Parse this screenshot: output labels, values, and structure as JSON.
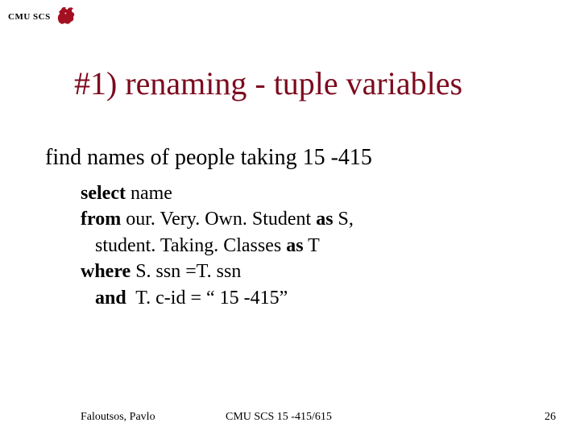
{
  "header": {
    "org": "CMU SCS"
  },
  "title": "#1) renaming - tuple variables",
  "subtitle": "find names of people taking 15 -415",
  "code": {
    "l1": {
      "kw": "select",
      "rest": " name"
    },
    "l2": {
      "kw1": "from",
      "mid": " our. Very. Own. Student ",
      "kw2": "as",
      "tail": " S,"
    },
    "l3": {
      "indent": "   student. Taking. Classes ",
      "kw": "as",
      "tail": " T"
    },
    "l4": {
      "kw": "where",
      "rest": " S. ssn =T. ssn"
    },
    "l5": {
      "kw": "   and",
      "rest": "  T. c-id = “ 15 -415”"
    }
  },
  "footer": {
    "left": "Faloutsos, Pavlo",
    "center": "CMU SCS 15 -415/615",
    "right": "26"
  }
}
